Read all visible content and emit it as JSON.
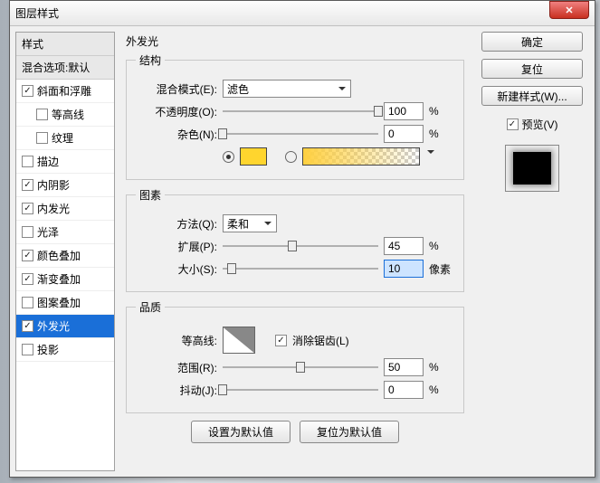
{
  "title": "图层样式",
  "sidebar": {
    "header": "样式",
    "blend_header": "混合选项:默认",
    "items": [
      {
        "label": "斜面和浮雕",
        "checked": true,
        "indent": false
      },
      {
        "label": "等高线",
        "checked": false,
        "indent": true
      },
      {
        "label": "纹理",
        "checked": false,
        "indent": true
      },
      {
        "label": "描边",
        "checked": false,
        "indent": false
      },
      {
        "label": "内阴影",
        "checked": true,
        "indent": false
      },
      {
        "label": "内发光",
        "checked": true,
        "indent": false
      },
      {
        "label": "光泽",
        "checked": false,
        "indent": false
      },
      {
        "label": "颜色叠加",
        "checked": true,
        "indent": false
      },
      {
        "label": "渐变叠加",
        "checked": true,
        "indent": false
      },
      {
        "label": "图案叠加",
        "checked": false,
        "indent": false
      },
      {
        "label": "外发光",
        "checked": true,
        "indent": false,
        "selected": true
      },
      {
        "label": "投影",
        "checked": false,
        "indent": false
      }
    ]
  },
  "main": {
    "panel_title": "外发光",
    "struct": {
      "legend": "结构",
      "blend_label": "混合模式(E):",
      "blend_value": "滤色",
      "opacity_label": "不透明度(O):",
      "opacity_value": "100",
      "opacity_unit": "%",
      "noise_label": "杂色(N):",
      "noise_value": "0",
      "noise_unit": "%",
      "swatch_color": "#ffd52e"
    },
    "elem": {
      "legend": "图素",
      "method_label": "方法(Q):",
      "method_value": "柔和",
      "spread_label": "扩展(P):",
      "spread_value": "45",
      "spread_unit": "%",
      "size_label": "大小(S):",
      "size_value": "10",
      "size_unit": "像素"
    },
    "qual": {
      "legend": "品质",
      "contour_label": "等高线:",
      "aa_label": "消除锯齿(L)",
      "aa_checked": true,
      "range_label": "范围(R):",
      "range_value": "50",
      "range_unit": "%",
      "jitter_label": "抖动(J):",
      "jitter_value": "0",
      "jitter_unit": "%"
    },
    "buttons": {
      "set_default": "设置为默认值",
      "reset_default": "复位为默认值"
    }
  },
  "right": {
    "ok": "确定",
    "reset": "复位",
    "new_style": "新建样式(W)...",
    "preview_label": "预览(V)",
    "preview_checked": true
  }
}
